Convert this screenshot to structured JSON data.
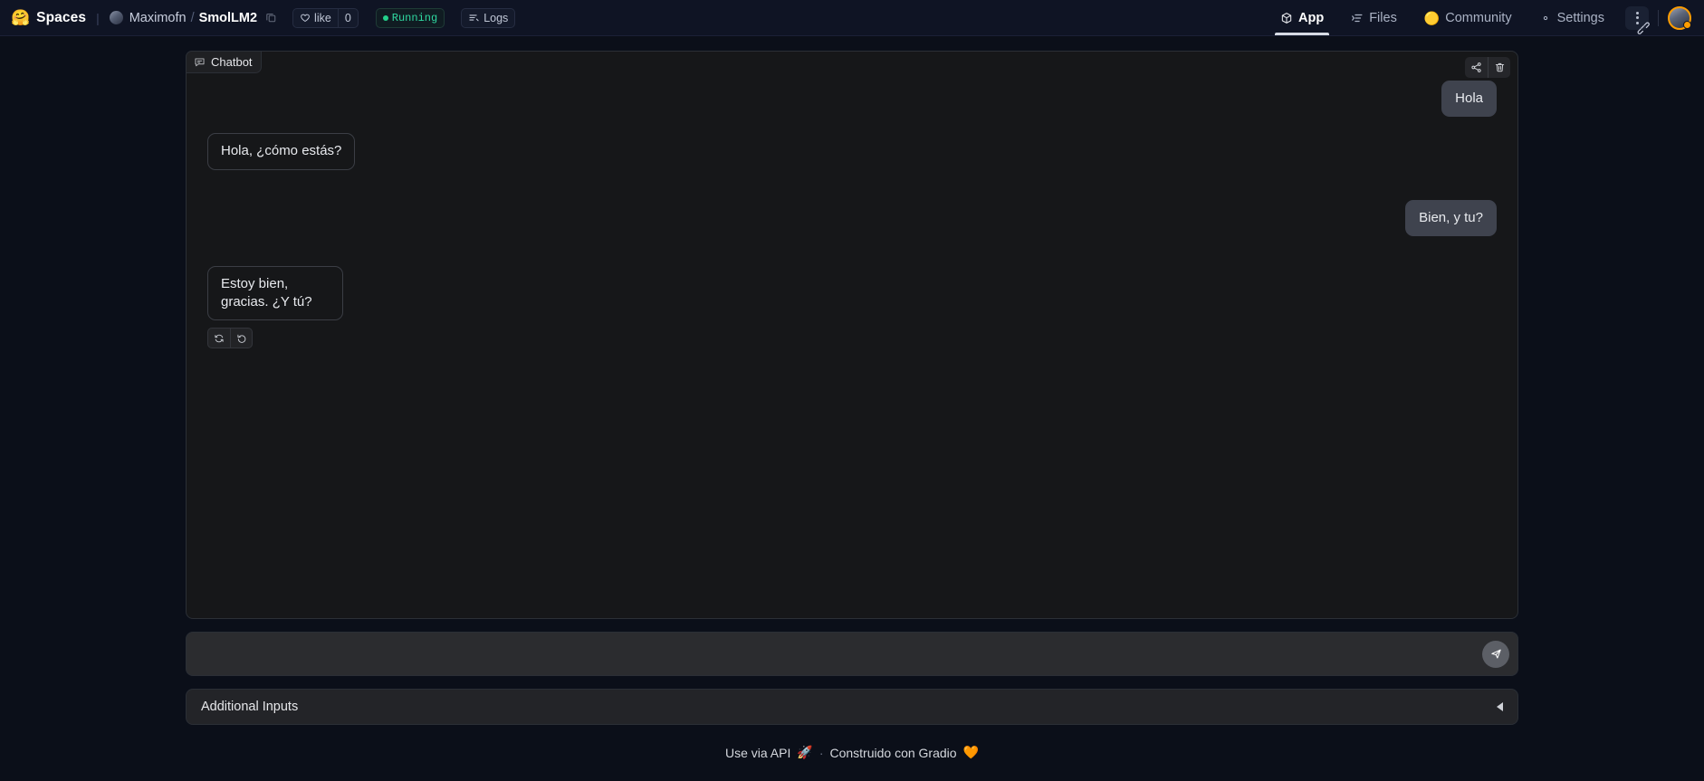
{
  "header": {
    "logo_icon": "hugging-face-emoji",
    "logo_emoji": "🤗",
    "product": "Spaces",
    "separator": "|",
    "repo": {
      "owner": "Maximofn",
      "slash": "/",
      "name": "SmolLM2",
      "copy_icon": "copy-icon"
    },
    "like": {
      "icon": "heart-icon",
      "label": "like",
      "count": "0"
    },
    "status": {
      "label": "Running",
      "dot_color": "#23d18b"
    },
    "logs": {
      "icon": "logs-icon",
      "label": "Logs"
    },
    "nav": [
      {
        "label": "App",
        "icon": "box-icon",
        "active": true
      },
      {
        "label": "Files",
        "icon": "files-icon",
        "active": false
      },
      {
        "label": "Community",
        "icon": "community-emoji",
        "emoji": "🟡",
        "active": false
      },
      {
        "label": "Settings",
        "icon": "gear-icon",
        "active": false
      }
    ],
    "kebab_icon": "kebab-menu-icon",
    "avatar_icon": "user-avatar"
  },
  "chatbot": {
    "label": "Chatbot",
    "label_icon": "chat-bubble-icon",
    "tools": [
      {
        "name": "share-icon",
        "title": "Share"
      },
      {
        "name": "trash-icon",
        "title": "Clear"
      }
    ],
    "messages": [
      {
        "role": "user",
        "text": "Hola"
      },
      {
        "role": "bot",
        "text": "Hola, ¿cómo estás?"
      },
      {
        "role": "user",
        "text": "Bien, y tu?"
      },
      {
        "role": "bot",
        "text": "Estoy bien, gracias. ¿Y tú?"
      }
    ],
    "actions": [
      {
        "name": "retry-icon",
        "title": "Retry"
      },
      {
        "name": "undo-icon",
        "title": "Undo"
      }
    ]
  },
  "input": {
    "value": "",
    "placeholder": "",
    "send_icon": "send-paper-plane-icon"
  },
  "accordion": {
    "title": "Additional Inputs",
    "caret_icon": "caret-left-icon",
    "expanded": false
  },
  "footer": {
    "api_label": "Use via API",
    "api_emoji": "🚀",
    "middot": "·",
    "built_with": "Construido con Gradio",
    "gradio_emoji": "🧡"
  },
  "colors": {
    "page_bg": "#0b0f19",
    "header_bg": "#0f1424",
    "panel_bg": "#161719",
    "user_bubble": "#3f434e",
    "accent_orange": "#ff9d00",
    "running_green": "#23d18b"
  }
}
